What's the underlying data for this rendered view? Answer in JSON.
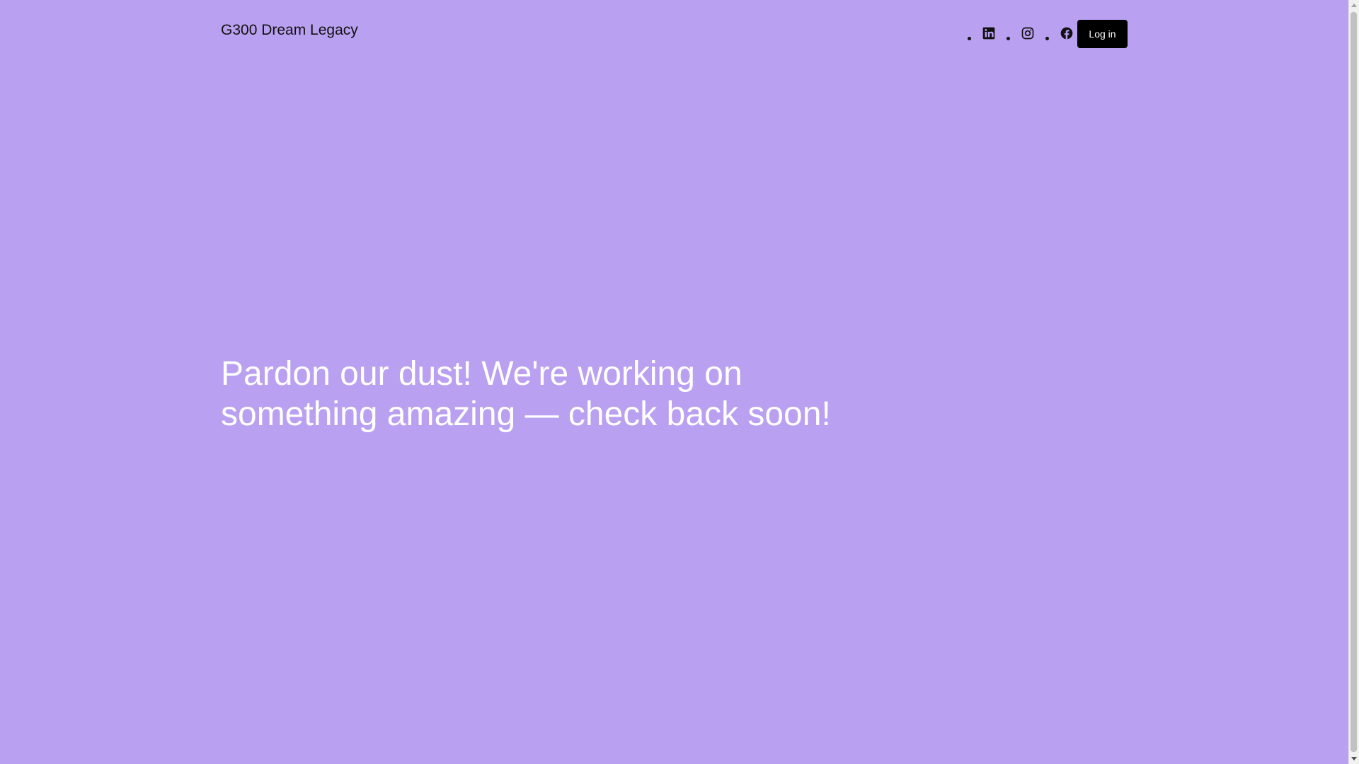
{
  "site": {
    "title": "G300 Dream Legacy"
  },
  "social": {
    "items": [
      {
        "name": "linkedin",
        "icon": "linkedin-icon"
      },
      {
        "name": "instagram",
        "icon": "instagram-icon"
      },
      {
        "name": "facebook",
        "icon": "facebook-icon"
      }
    ]
  },
  "header": {
    "login_label": "Log in"
  },
  "main": {
    "headline": "Pardon our dust! We're working on something amazing — check back soon!"
  },
  "colors": {
    "background": "#baa0f0",
    "text": "#111111",
    "headline": "#ffffff",
    "button_bg": "#000000",
    "button_text": "#ffffff"
  }
}
